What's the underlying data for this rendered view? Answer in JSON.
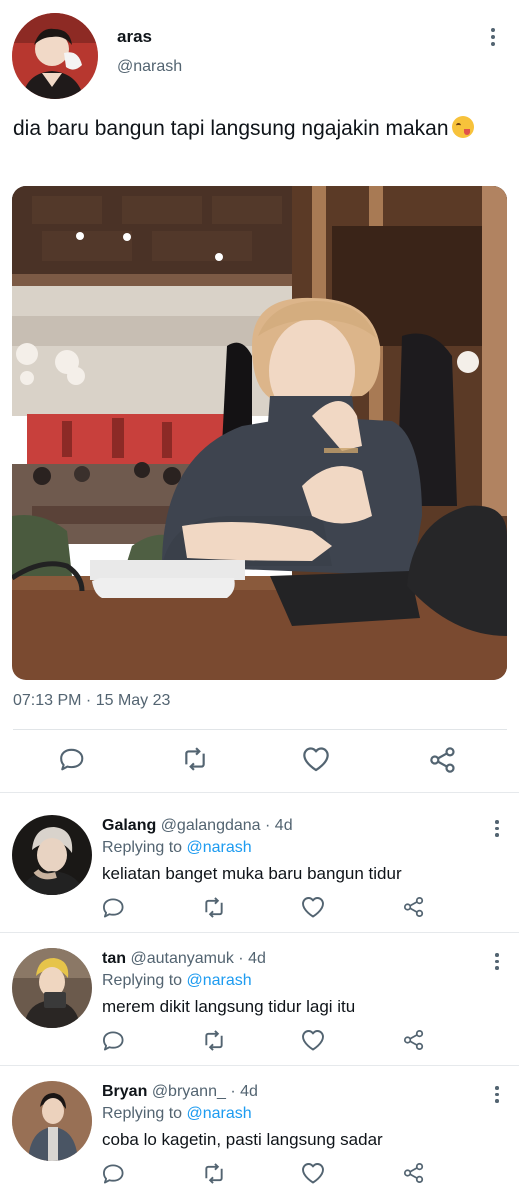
{
  "tweet": {
    "author": {
      "name": "aras",
      "handle": "@narash"
    },
    "text": "dia baru bangun tapi langsung ngajakin makan",
    "emoji": "face-savoring-food-emoji",
    "timestamp": "07:13 PM · 15 May 23",
    "actions": [
      "reply-icon",
      "retweet-icon",
      "like-icon",
      "share-icon"
    ]
  },
  "replies": [
    {
      "name": "Galang",
      "handle": "@galangdana · 4d",
      "replying_prefix": "Replying to ",
      "replying_to": "@narash",
      "text": "keliatan banget muka baru bangun tidur"
    },
    {
      "name": "tan",
      "handle": "@autanyamuk · 4d",
      "replying_prefix": "Replying to ",
      "replying_to": "@narash",
      "text": "merem dikit langsung tidur lagi itu"
    },
    {
      "name": "Bryan",
      "handle": "@bryann_ · 4d",
      "replying_prefix": "Replying to ",
      "replying_to": "@narash",
      "text": "coba lo kagetin, pasti langsung sadar"
    }
  ],
  "colors": {
    "text": "#0f1419",
    "secondary": "#536471",
    "link": "#1d9bf0",
    "divider": "#e1e5e8"
  }
}
